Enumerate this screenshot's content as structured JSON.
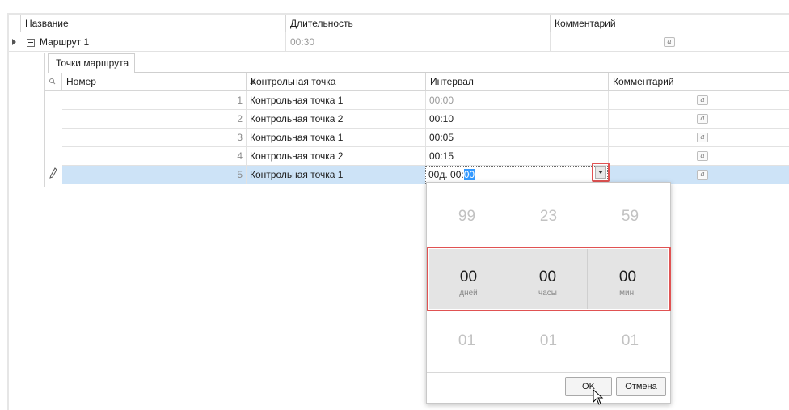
{
  "main_grid": {
    "columns": [
      "Название",
      "Длительность",
      "Комментарий"
    ],
    "row": {
      "name": "Маршрут 1",
      "duration": "00:30"
    }
  },
  "detail": {
    "tab_label": "Точки маршрута",
    "columns": {
      "number": "Номер",
      "checkpoint": "Контрольная точка",
      "interval": "Интервал",
      "comment": "Комментарий"
    },
    "rows": [
      {
        "number": "1",
        "checkpoint": "Контрольная точка 1",
        "interval": "00:00",
        "interval_muted": true
      },
      {
        "number": "2",
        "checkpoint": "Контрольная точка 2",
        "interval": "00:10"
      },
      {
        "number": "3",
        "checkpoint": "Контрольная точка 1",
        "interval": "00:05"
      },
      {
        "number": "4",
        "checkpoint": "Контрольная точка 2",
        "interval": "00:15"
      },
      {
        "number": "5",
        "checkpoint": "Контрольная точка 1",
        "interval_edit_prefix": "00д. 00:",
        "interval_edit_selected": "00",
        "selected": true
      }
    ],
    "memo_icon_glyph": "a"
  },
  "picker": {
    "above": {
      "days": "99",
      "hours": "23",
      "minutes": "59"
    },
    "selected": {
      "days": "00",
      "hours": "00",
      "minutes": "00"
    },
    "units": {
      "days": "дней",
      "hours": "часы",
      "minutes": "мин."
    },
    "below": {
      "days": "01",
      "hours": "01",
      "minutes": "01"
    },
    "ok_label": "OK",
    "cancel_label": "Отмена"
  },
  "colors": {
    "selection": "#cde3f7",
    "highlight_box": "#e05252",
    "text_selection": "#3399ff"
  },
  "icons": [
    "row-indicator-arrow-icon",
    "collapse-icon",
    "memo-icon",
    "search-icon",
    "sort-ascending-icon",
    "pencil-icon",
    "dropdown-arrow-icon",
    "mouse-cursor-icon"
  ]
}
